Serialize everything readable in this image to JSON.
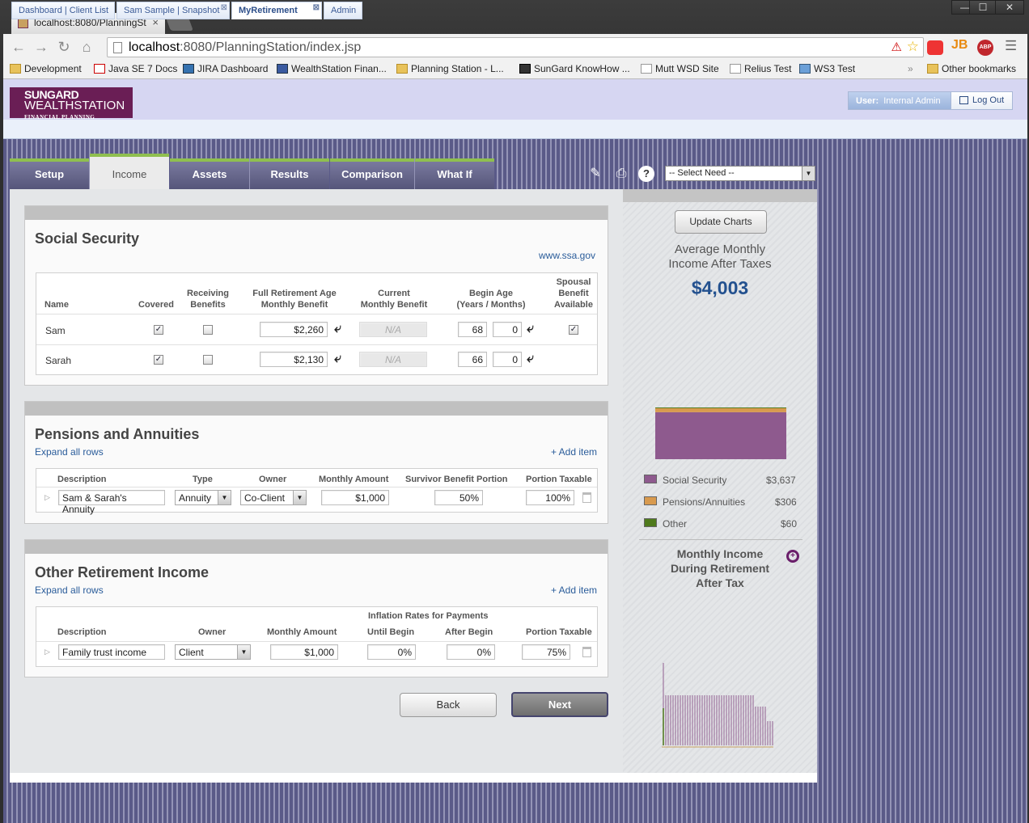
{
  "browser": {
    "tab_title": "localhost:8080/PlanningSt",
    "url_host": "localhost",
    "url_rest": ":8080/PlanningStation/index.jsp",
    "window_controls": [
      "—",
      "☐",
      "✕"
    ],
    "bookmarks": [
      "Development",
      "Java SE 7 Docs",
      "JIRA Dashboard",
      "WealthStation Finan...",
      "Planning Station - L...",
      "SunGard KnowHow ...",
      "Mutt WSD Site",
      "Relius Test",
      "WS3 Test"
    ],
    "other_bookmarks": "Other bookmarks",
    "overflow": "»",
    "ext_jb": "JB",
    "ext_abp": "ABP"
  },
  "app": {
    "logo_line1": "SUNGARD",
    "logo_line2": "WEALTHSTATION",
    "logo_line3": "FINANCIAL PLANNING",
    "user_label": "User:",
    "user_name": "Internal Admin",
    "logout": "Log Out",
    "tabs": [
      "Dashboard | Client List",
      "Sam Sample | Snapshot",
      "MyRetirement",
      "Admin"
    ]
  },
  "nav": {
    "tabs": [
      "Setup",
      "Income",
      "Assets",
      "Results",
      "Comparison",
      "What If"
    ],
    "active": "Income",
    "need_select": "-- Select Need --"
  },
  "social_security": {
    "title": "Social Security",
    "link": "www.ssa.gov",
    "headers": {
      "name": "Name",
      "covered": "Covered",
      "receiving1": "Receiving",
      "receiving2": "Benefits",
      "fra1": "Full Retirement Age",
      "fra2": "Monthly Benefit",
      "cur1": "Current",
      "cur2": "Monthly Benefit",
      "age1": "Begin Age",
      "age2": "(Years / Months)",
      "sp1": "Spousal",
      "sp2": "Benefit",
      "sp3": "Available"
    },
    "rows": [
      {
        "name": "Sam",
        "covered": true,
        "receiving": false,
        "benefit": "$2,260",
        "current": "N/A",
        "years": "68",
        "months": "0",
        "spousal": true
      },
      {
        "name": "Sarah",
        "covered": true,
        "receiving": false,
        "benefit": "$2,130",
        "current": "N/A",
        "years": "66",
        "months": "0",
        "spousal": false
      }
    ]
  },
  "pensions": {
    "title": "Pensions and Annuities",
    "expand": "Expand all rows",
    "add": "+ Add item",
    "headers": [
      "Description",
      "Type",
      "Owner",
      "Monthly Amount",
      "Survivor Benefit Portion",
      "Portion Taxable"
    ],
    "rows": [
      {
        "description": "Sam & Sarah's Annuity",
        "type": "Annuity",
        "owner": "Co-Client",
        "amount": "$1,000",
        "survivor": "50%",
        "taxable": "100%"
      }
    ]
  },
  "other_income": {
    "title": "Other Retirement Income",
    "expand": "Expand all rows",
    "add": "+ Add item",
    "inflation_header": "Inflation Rates for Payments",
    "headers": [
      "Description",
      "Owner",
      "Monthly Amount",
      "Until Begin",
      "After Begin",
      "Portion Taxable"
    ],
    "rows": [
      {
        "description": "Family trust income",
        "owner": "Client",
        "amount": "$1,000",
        "until": "0%",
        "after": "0%",
        "taxable": "75%"
      }
    ]
  },
  "buttons": {
    "back": "Back",
    "next": "Next"
  },
  "sidebar": {
    "update": "Update Charts",
    "avg_title1": "Average Monthly",
    "avg_title2": "Income After Taxes",
    "avg_value": "$4,003",
    "income_title1": "Monthly Income",
    "income_title2": "During Retirement",
    "income_title3": "After Tax"
  },
  "colors": {
    "social_security": "#8e5a8e",
    "pensions": "#d89a4e",
    "other": "#4f7a1c"
  },
  "chart_data": {
    "type": "bar",
    "categories": [
      "Social Security",
      "Pensions/Annuities",
      "Other"
    ],
    "series": [
      {
        "values": [
          3637,
          306,
          60
        ]
      }
    ],
    "labels": [
      "$3,637",
      "$306",
      "$60"
    ],
    "stacked": true
  }
}
